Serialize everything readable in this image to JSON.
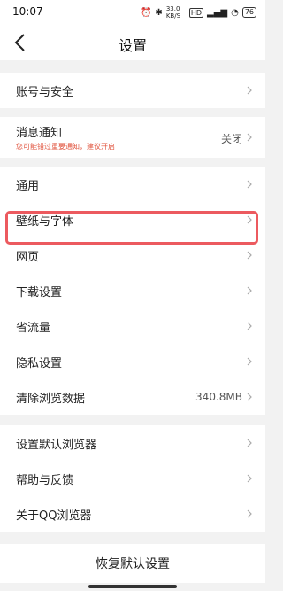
{
  "status": {
    "time": "10:07",
    "speed": "33.0 KB/S",
    "battery": "76"
  },
  "nav": {
    "title": "设置"
  },
  "groups": {
    "account": {
      "label": "账号与安全"
    },
    "notify": {
      "label": "消息通知",
      "sub": "您可能错过重要通知，建议开启",
      "value": "关闭"
    },
    "general": {
      "items": [
        "通用",
        "壁纸与字体",
        "网页",
        "下载设置",
        "省流量",
        "隐私设置",
        "清除浏览数据"
      ],
      "clear_value": "340.8MB"
    },
    "browser": {
      "items": [
        "设置默认浏览器",
        "帮助与反馈",
        "关于QQ浏览器"
      ]
    }
  },
  "reset": {
    "label": "恢复默认设置"
  },
  "colors": {
    "highlight": "#ec5a5f",
    "hint_red": "#e0503a"
  }
}
